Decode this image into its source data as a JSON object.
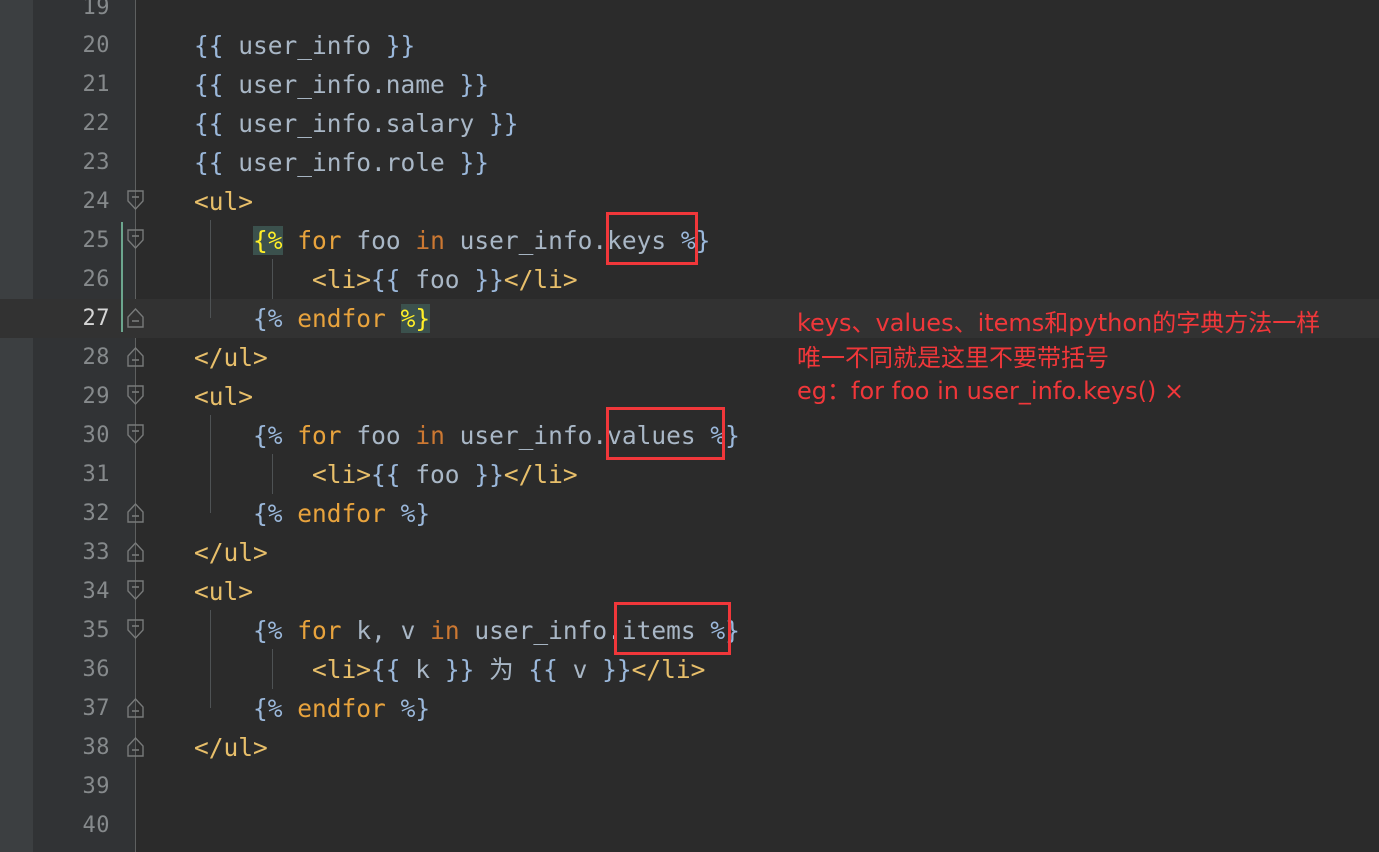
{
  "editor": {
    "theme_name": "darcula",
    "background": "#2B2B2B",
    "gutter_background": "#313335",
    "strip_background": "#3C3F41",
    "current_line_background": "#323232",
    "current_line": 27,
    "first_visible_line": 19,
    "last_visible_line": 40
  },
  "lines": [
    {
      "number": "19",
      "text": "",
      "fold": "none"
    },
    {
      "number": "20",
      "text": "{{ user_info }}",
      "fold": "none"
    },
    {
      "number": "21",
      "text": "{{ user_info.name }}",
      "fold": "none"
    },
    {
      "number": "22",
      "text": "{{ user_info.salary }}",
      "fold": "none"
    },
    {
      "number": "23",
      "text": "{{ user_info.role }}",
      "fold": "none"
    },
    {
      "number": "24",
      "text": "<ul>",
      "fold": "open"
    },
    {
      "number": "25",
      "text": "    {% for foo in user_info.keys %}",
      "fold": "open"
    },
    {
      "number": "26",
      "text": "        <li>{{ foo }}</li>",
      "fold": "none"
    },
    {
      "number": "27",
      "text": "    {% endfor %}",
      "fold": "close"
    },
    {
      "number": "28",
      "text": "</ul>",
      "fold": "close"
    },
    {
      "number": "29",
      "text": "<ul>",
      "fold": "open"
    },
    {
      "number": "30",
      "text": "    {% for foo in user_info.values %}",
      "fold": "open"
    },
    {
      "number": "31",
      "text": "        <li>{{ foo }}</li>",
      "fold": "none"
    },
    {
      "number": "32",
      "text": "    {% endfor %}",
      "fold": "close"
    },
    {
      "number": "33",
      "text": "</ul>",
      "fold": "close"
    },
    {
      "number": "34",
      "text": "<ul>",
      "fold": "open"
    },
    {
      "number": "35",
      "text": "    {% for k, v in user_info.items %}",
      "fold": "open"
    },
    {
      "number": "36",
      "text": "        <li>{{ k }} 为 {{ v }}</li>",
      "fold": "none"
    },
    {
      "number": "37",
      "text": "    {% endfor %}",
      "fold": "close"
    },
    {
      "number": "38",
      "text": "</ul>",
      "fold": "close"
    },
    {
      "number": "39",
      "text": "",
      "fold": "none"
    },
    {
      "number": "40",
      "text": "",
      "fold": "none"
    }
  ],
  "annotations": {
    "accent_color": "#F0373A",
    "boxes": [
      {
        "id": "box-keys",
        "target": ".keys",
        "line": 25
      },
      {
        "id": "box-values",
        "target": ".values",
        "line": 30
      },
      {
        "id": "box-items",
        "target": ".items",
        "line": 35
      }
    ],
    "note_lines": [
      "keys、values、items和python的字典方法一样",
      "唯一不同就是这里不要带括号",
      "eg：for foo in user_info.keys() ×"
    ]
  },
  "colors": {
    "tag": "#E8BF6A",
    "braces": "#9BB8DB",
    "keyword": "#E8A33D",
    "keyword_in": "#CC7832",
    "identifier": "#A9B7C6",
    "match_background": "#3B514D",
    "match_foreground": "#FFEF28",
    "line_number": "#868A8C",
    "line_number_active": "#D6D6D6",
    "change_marker": "#6CA68E",
    "fold_marker": "#787A7A",
    "indent_guide": "#4E5254"
  }
}
